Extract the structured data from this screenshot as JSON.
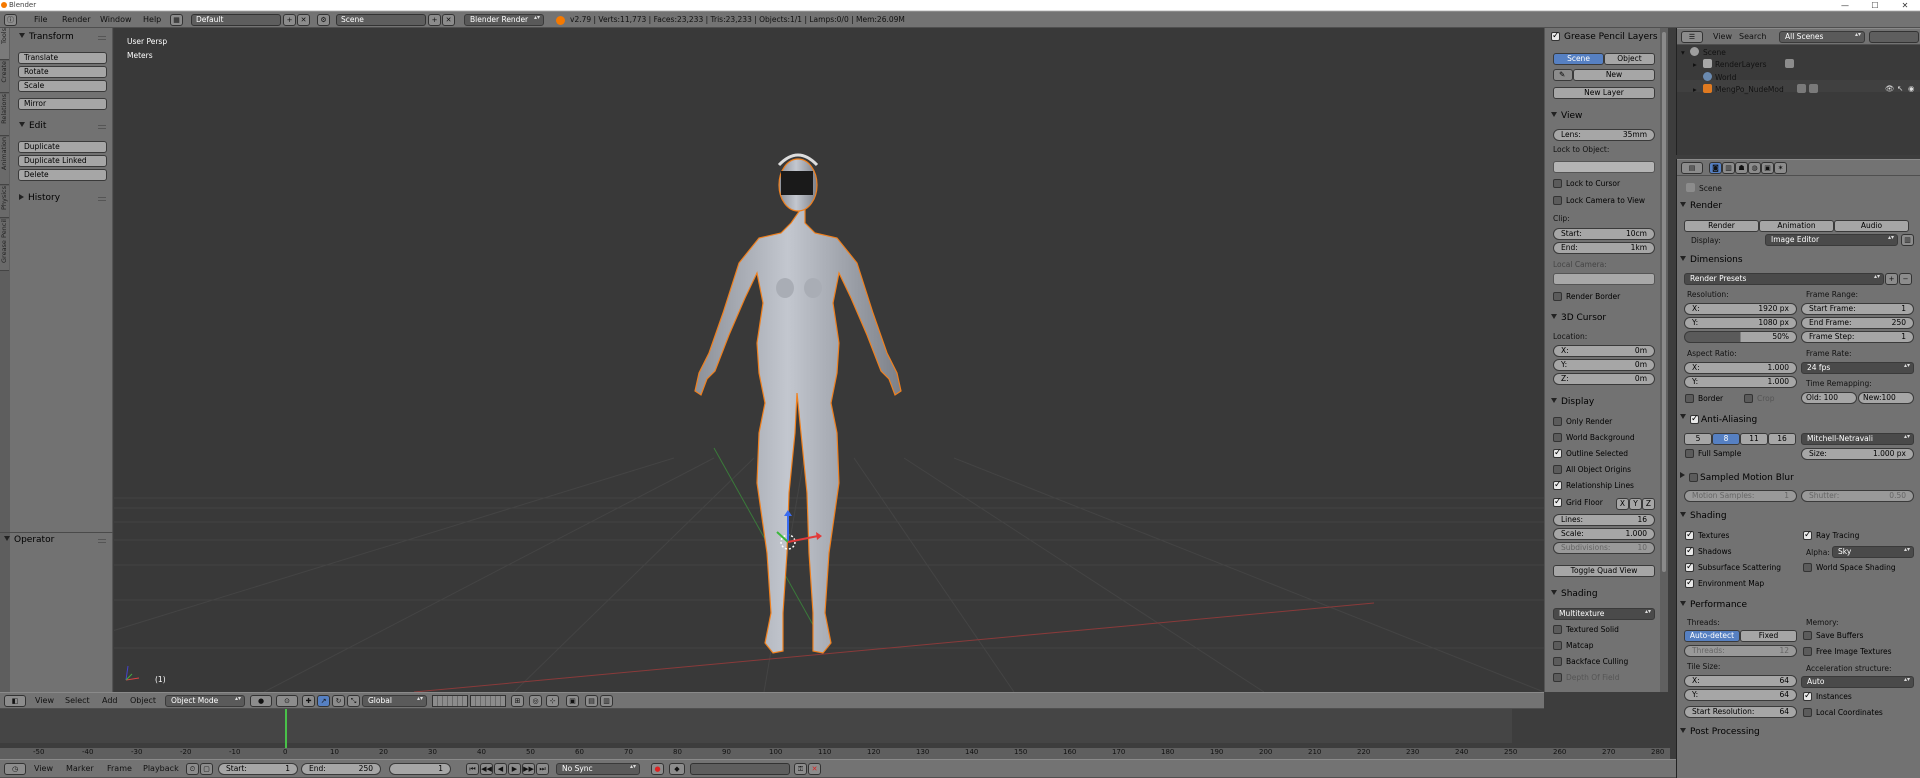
{
  "window": {
    "title": "Blender",
    "min": "—",
    "max": "☐",
    "close": "✕"
  },
  "topbar": {
    "menus": [
      "File",
      "Render",
      "Window",
      "Help"
    ],
    "screen_layout": "Default",
    "scene": "Scene",
    "engine": "Blender Render",
    "stats": "v2.79 | Verts:11,773 | Faces:23,233 | Tris:23,233 | Objects:1/1 | Lamps:0/0 | Mem:26.09M"
  },
  "tool_tabs": [
    "Tools",
    "Create",
    "Relations",
    "Animation",
    "Physics",
    "Grease Pencil"
  ],
  "toolshelf": {
    "transform": {
      "title": "Transform",
      "buttons": [
        "Translate",
        "Rotate",
        "Scale",
        "Mirror"
      ]
    },
    "edit": {
      "title": "Edit",
      "buttons": [
        "Duplicate",
        "Duplicate Linked",
        "Delete"
      ]
    },
    "history": {
      "title": "History"
    },
    "operator": {
      "title": "Operator"
    }
  },
  "viewport": {
    "view_name": "User Persp",
    "units": "Meters",
    "frame": "(1)"
  },
  "view3d_header": {
    "menus": [
      "View",
      "Select",
      "Add",
      "Object"
    ],
    "mode": "Object Mode",
    "orientation": "Global"
  },
  "timeline": {
    "ticks": [
      "-50",
      "-40",
      "-30",
      "-20",
      "-10",
      "0",
      "10",
      "20",
      "30",
      "40",
      "50",
      "60",
      "70",
      "80",
      "90",
      "100",
      "110",
      "120",
      "130",
      "140",
      "150",
      "160",
      "170",
      "180",
      "190",
      "200",
      "210",
      "220",
      "230",
      "240",
      "250",
      "260",
      "270",
      "280"
    ],
    "menus": [
      "View",
      "Marker",
      "Frame",
      "Playback"
    ],
    "start_label": "Start:",
    "start": "1",
    "end_label": "End:",
    "end": "250",
    "current": "1",
    "sync": "No Sync"
  },
  "npanel": {
    "grease_pencil": {
      "title": "Grease Pencil Layers",
      "scene_btn": "Scene",
      "object_btn": "Object",
      "new_btn": "New",
      "new_layer_btn": "New Layer"
    },
    "view": {
      "title": "View",
      "lens_label": "Lens:",
      "lens": "35mm",
      "lock_label": "Lock to Object:",
      "lock_cursor": "Lock to Cursor",
      "lock_camera": "Lock Camera to View",
      "clip_label": "Clip:",
      "clip_start_label": "Start:",
      "clip_start": "10cm",
      "clip_end_label": "End:",
      "clip_end": "1km",
      "local_camera": "Local Camera:",
      "render_border": "Render Border"
    },
    "cursor": {
      "title": "3D Cursor",
      "location": "Location:",
      "x_label": "X:",
      "x": "0m",
      "y_label": "Y:",
      "y": "0m",
      "z_label": "Z:",
      "z": "0m"
    },
    "display": {
      "title": "Display",
      "only_render": "Only Render",
      "world_bg": "World Background",
      "outline": "Outline Selected",
      "all_origins": "All Object Origins",
      "rel_lines": "Relationship Lines",
      "grid_floor": "Grid Floor",
      "gx": "X",
      "gy": "Y",
      "gz": "Z",
      "lines_label": "Lines:",
      "lines": "16",
      "scale_label": "Scale:",
      "scale": "1.000",
      "subdiv_label": "Subdivisions:",
      "subdiv": "10",
      "quad": "Toggle Quad View"
    },
    "shading": {
      "title": "Shading",
      "mode": "Multitexture",
      "textured_solid": "Textured Solid",
      "matcap": "Matcap",
      "backface": "Backface Culling",
      "dof": "Depth Of Field"
    }
  },
  "outliner": {
    "view": "View",
    "search": "Search",
    "filter": "All Scenes",
    "items": [
      {
        "label": "Scene"
      },
      {
        "label": "RenderLayers"
      },
      {
        "label": "World"
      },
      {
        "label": "MengPo_NudeMod"
      }
    ]
  },
  "properties": {
    "context": "Scene",
    "render": {
      "title": "Render",
      "render_btn": "Render",
      "animation_btn": "Animation",
      "audio_btn": "Audio",
      "display_label": "Display:",
      "display": "Image Editor"
    },
    "dimensions": {
      "title": "Dimensions",
      "presets": "Render Presets",
      "resolution": "Resolution:",
      "res_x_label": "X:",
      "res_x": "1920 px",
      "res_y_label": "Y:",
      "res_y": "1080 px",
      "res_pct": "50%",
      "aspect": "Aspect Ratio:",
      "asp_x_label": "X:",
      "asp_x": "1.000",
      "asp_y_label": "Y:",
      "asp_y": "1.000",
      "border": "Border",
      "crop": "Crop",
      "frame_range": "Frame Range:",
      "start_label": "Start Frame:",
      "start": "1",
      "end_label": "End Frame:",
      "end": "250",
      "step_label": "Frame Step:",
      "step": "1",
      "frame_rate": "Frame Rate:",
      "fps": "24 fps",
      "remap": "Time Remapping:",
      "old": "Old: 100",
      "new": "New:100"
    },
    "aa": {
      "title": "Anti-Aliasing",
      "samples": [
        "5",
        "8",
        "11",
        "16"
      ],
      "selected": "8",
      "filter": "Mitchell-Netravali",
      "full_sample": "Full Sample",
      "size_label": "Size:",
      "size": "1.000 px"
    },
    "motion_blur": {
      "title": "Sampled Motion Blur",
      "samples_label": "Motion Samples:",
      "samples": "1",
      "shutter_label": "Shutter:",
      "shutter": "0.50"
    },
    "shading": {
      "title": "Shading",
      "textures": "Textures",
      "shadows": "Shadows",
      "sss": "Subsurface Scattering",
      "env": "Environment Map",
      "ray": "Ray Tracing",
      "alpha_label": "Alpha:",
      "alpha": "Sky",
      "wss": "World Space Shading"
    },
    "performance": {
      "title": "Performance",
      "threads": "Threads:",
      "auto": "Auto-detect",
      "fixed": "Fixed",
      "threads_label": "Threads:",
      "threads_val": "12",
      "tile": "Tile Size:",
      "tx_label": "X:",
      "tx": "64",
      "ty_label": "Y:",
      "ty": "64",
      "startres_label": "Start Resolution:",
      "startres": "64",
      "memory": "Memory:",
      "save_buffers": "Save Buffers",
      "free_img": "Free Image Textures",
      "accel": "Acceleration structure:",
      "accel_val": "Auto",
      "instances": "Instances",
      "local_coords": "Local Coordinates"
    },
    "post": {
      "title": "Post Processing"
    }
  },
  "colors": {
    "accent": "#5680c2",
    "viewport_bg": "#393939",
    "panel": "#727272",
    "selection_outline": "#f0801e"
  }
}
